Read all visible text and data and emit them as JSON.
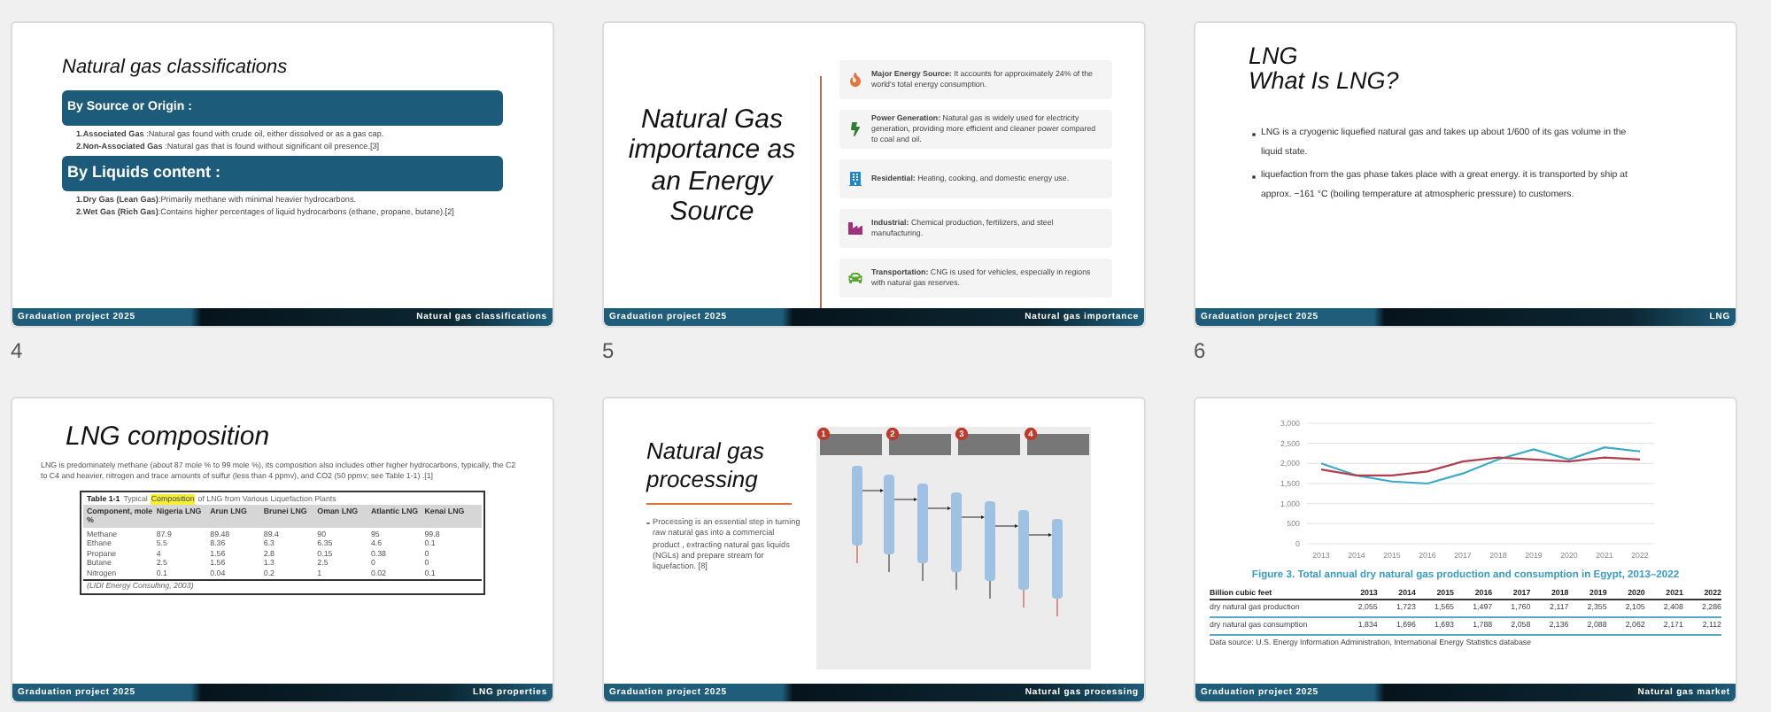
{
  "slides": [
    {
      "kind": "classifications",
      "number": "4",
      "title": "Natural gas classifications",
      "footer_left": "Graduation project 2025",
      "footer_right": "Natural gas classifications",
      "sections": [
        {
          "heading": "By Source or Origin :",
          "items": [
            "**1.Associated Gas** :Natural gas found with crude oil, either dissolved or as a gas cap.",
            "**2.Non-Associated Gas** :Natural gas that is found without significant oil presence.[3]"
          ]
        },
        {
          "heading": "By Liquids content :",
          "items": [
            "**1.Dry Gas (Lean Gas)**:Primarily methane with minimal heavier hydrocarbons.",
            "**2.Wet Gas (Rich Gas)**:Contains higher percentages of liquid hydrocarbons (ethane, propane, butane).[2]"
          ]
        }
      ]
    },
    {
      "kind": "importance",
      "number": "5",
      "title": "Natural Gas importance as an Energy Source",
      "footer_left": "Graduation project 2025",
      "footer_right": "Natural gas importance",
      "items": [
        {
          "kind": "flame",
          "color": "#e8743b",
          "text": "**Major Energy Source:** It accounts for approximately 24% of the world's total energy consumption."
        },
        {
          "kind": "power",
          "color": "#2e7d32",
          "text": "**Power Generation:** Natural gas is widely used for electricity generation, providing more efficient and cleaner power compared to coal and oil."
        },
        {
          "kind": "residential",
          "color": "#1e88c8",
          "text": "**Residential:** Heating, cooking, and domestic energy use."
        },
        {
          "kind": "industrial",
          "color": "#a0307a",
          "text": "**Industrial:** Chemical production, fertilizers, and steel manufacturing."
        },
        {
          "kind": "vehicle",
          "color": "#5aa832",
          "text": "**Transportation:** CNG is used for vehicles, especially in regions with natural gas reserves."
        }
      ]
    },
    {
      "kind": "bullets",
      "number": "6",
      "title_lines": [
        "LNG",
        "What Is LNG?"
      ],
      "footer_left": "Graduation project 2025",
      "footer_right": "LNG",
      "bullets": [
        "LNG is a cryogenic liquefied natural gas and takes up about 1/600 of its gas volume in the liquid state.",
        "liquefaction from the gas phase takes place with a great energy. it is transported by ship at approx. −161 °C (boiling temperature at atmospheric pressure) to customers."
      ]
    },
    {
      "kind": "composition",
      "title": "LNG composition",
      "footer_left": "Graduation project 2025",
      "footer_right": "LNG properties",
      "paragraph": "LNG is predominately methane (about 87 mole % to 99 mole %), its composition also includes other higher hydrocarbons, typically, the C2 to C4 and heavier, nitrogen and trace amounts of sulfur (less than 4 ppmv), and CO2 (50 ppmv; see Table 1-1) .[1]",
      "table": {
        "label": "Table 1-1",
        "caption_before": "Typical",
        "caption_highlight": "Composition",
        "caption_after": "of LNG from Various Liquefaction Plants",
        "columns": [
          "Component, mole %",
          "Nigeria LNG",
          "Arun LNG",
          "Brunei LNG",
          "Oman LNG",
          "Atlantic LNG",
          "Kenai LNG"
        ],
        "rows": [
          [
            "Methane",
            "87.9",
            "89.48",
            "89.4",
            "90",
            "95",
            "99.8"
          ],
          [
            "Ethane",
            "5.5",
            "8.36",
            "6.3",
            "6.35",
            "4.6",
            "0.1"
          ],
          [
            "Propane",
            "4",
            "1.56",
            "2.8",
            "0.15",
            "0.38",
            "0"
          ],
          [
            "Butane",
            "2.5",
            "1.56",
            "1.3",
            "2.5",
            "0",
            "0"
          ],
          [
            "Nitrogen",
            "0.1",
            "0.04",
            "0.2",
            "1",
            "0.02",
            "0.1"
          ]
        ],
        "source": "(LIDI Energy Consulting, 2003)"
      }
    },
    {
      "kind": "processing",
      "title": "Natural gas processing",
      "footer_left": "Graduation project 2025",
      "footer_right": "Natural gas processing",
      "bullet": "Processing is an essential step in turning raw natural gas into a commercial product , extracting natural gas liquids (NGLs) and prepare stream for liquefaction. [8]",
      "diagram": {
        "steps": [
          "1",
          "2",
          "3",
          "4"
        ]
      }
    },
    {
      "kind": "market",
      "title": "Figure 3. Total annual dry natural gas production and consumption in Egypt, 2013–2022",
      "footer_left": "Graduation project 2025",
      "footer_right": "Natural gas market",
      "chart_data": {
        "type": "line",
        "grid": true,
        "x": [
          "2013",
          "2014",
          "2015",
          "2016",
          "2017",
          "2018",
          "2019",
          "2020",
          "2021",
          "2022"
        ],
        "ylim": [
          0,
          3000
        ],
        "yticks": [
          {
            "value": 0,
            "label": "0"
          },
          {
            "value": 500,
            "label": "500"
          },
          {
            "value": 1000,
            "label": "1,000"
          },
          {
            "value": 1500,
            "label": "1,500"
          },
          {
            "value": 2000,
            "label": "2,000"
          },
          {
            "value": 2500,
            "label": "2,500"
          },
          {
            "value": 3000,
            "label": "3,000"
          }
        ],
        "series": [
          {
            "color": "#3aa9cc",
            "values": [
              2000,
              1700,
              1550,
              1500,
              1750,
              2100,
              2350,
              2100,
              2400,
              2300
            ]
          },
          {
            "color": "#b0404f",
            "values": [
              1850,
              1700,
              1700,
              1800,
              2050,
              2150,
              2100,
              2050,
              2150,
              2100
            ]
          }
        ]
      },
      "table": {
        "columns": [
          "Billion cubic feet",
          "2013",
          "2014",
          "2015",
          "2016",
          "2017",
          "2018",
          "2019",
          "2020",
          "2021",
          "2022"
        ],
        "rows": [
          [
            "dry natural gas production",
            "2,055",
            "1,723",
            "1,565",
            "1,497",
            "1,760",
            "2,117",
            "2,355",
            "2,105",
            "2,408",
            "2,286"
          ],
          [
            "dry natural gas consumption",
            "1,834",
            "1,696",
            "1,693",
            "1,788",
            "2,058",
            "2,136",
            "2,088",
            "2,062",
            "2,171",
            "2,112"
          ]
        ]
      },
      "source": "Data source: U.S. Energy Information Administration, International Energy Statistics database"
    }
  ]
}
